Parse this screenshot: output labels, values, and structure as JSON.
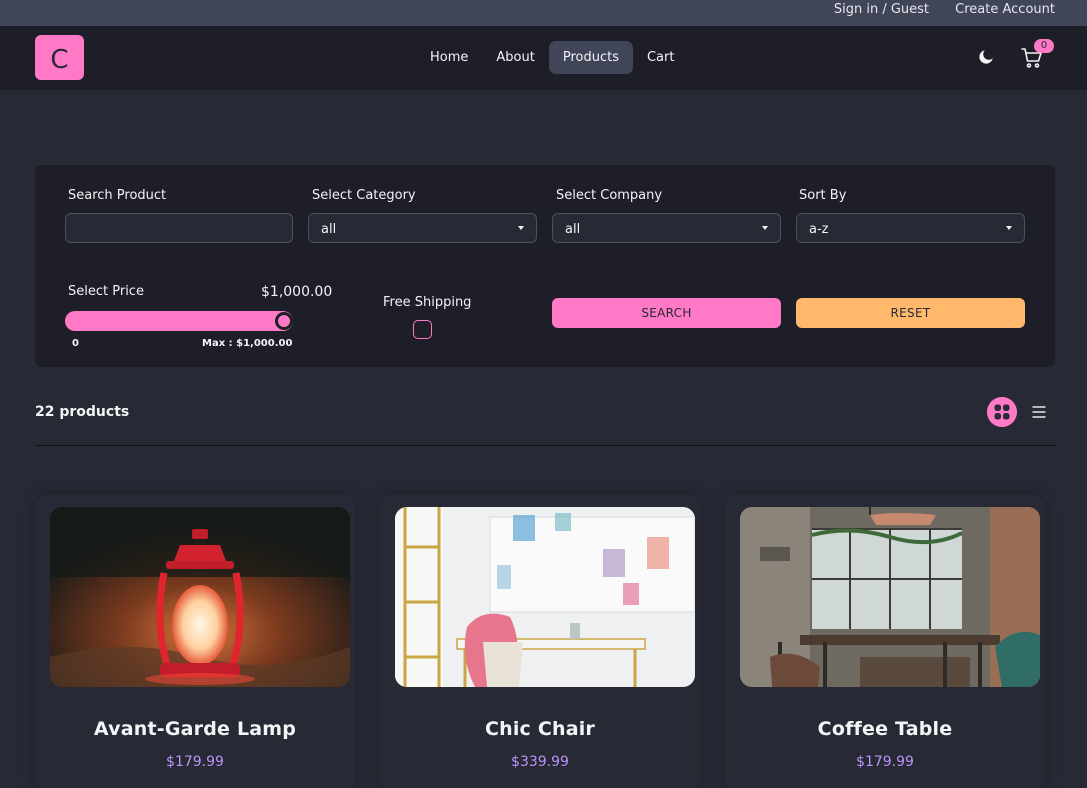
{
  "topbar": {
    "signin": "Sign in / Guest",
    "create": "Create Account"
  },
  "nav": {
    "logo": "C",
    "links": [
      "Home",
      "About",
      "Products",
      "Cart"
    ],
    "active": "Products",
    "cart_count": "0",
    "icons": {
      "theme": "moon-icon",
      "cart": "cart-icon"
    }
  },
  "filters": {
    "search_label": "Search Product",
    "search_value": "",
    "category_label": "Select Category",
    "category_value": "all",
    "company_label": "Select Company",
    "company_value": "all",
    "sort_label": "Sort By",
    "sort_value": "a-z",
    "price_label": "Select Price",
    "price_value": "$1,000.00",
    "price_min": "0",
    "price_max": "Max : $1,000.00",
    "price_fraction": 1.0,
    "shipping_label": "Free Shipping",
    "shipping_checked": false,
    "search_button": "SEARCH",
    "reset_button": "RESET"
  },
  "results": {
    "count": "22 products",
    "view": "grid"
  },
  "products": [
    {
      "name": "Avant-Garde Lamp",
      "price": "$179.99"
    },
    {
      "name": "Chic Chair",
      "price": "$339.99"
    },
    {
      "name": "Coffee Table",
      "price": "$179.99"
    }
  ],
  "colors": {
    "primary": "#ff79c6",
    "secondary": "#bd93f9",
    "accent": "#ffb86c",
    "background": "#272935"
  }
}
